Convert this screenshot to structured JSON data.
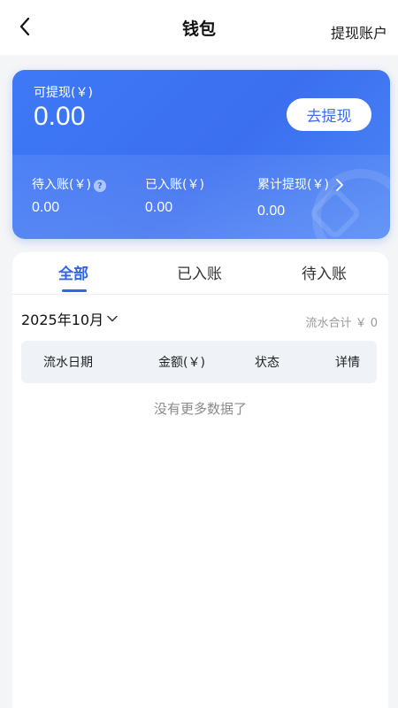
{
  "header": {
    "title": "钱包",
    "right_action": "提现账户"
  },
  "wallet": {
    "available_label": "可提现(￥)",
    "available_amount": "0.00",
    "withdraw_button": "去提现",
    "stats": [
      {
        "label": "待入账(￥)",
        "value": "0.00"
      },
      {
        "label": "已入账(￥)",
        "value": "0.00"
      },
      {
        "label": "累计提现(￥)",
        "value": "0.00"
      }
    ]
  },
  "tabs": [
    "全部",
    "已入账",
    "待入账"
  ],
  "filter": {
    "month": "2025年10月",
    "total_label": "流水合计 ￥ 0"
  },
  "table": {
    "columns": [
      "流水日期",
      "金额(￥)",
      "状态",
      "详情"
    ],
    "empty_text": "没有更多数据了"
  },
  "colors": {
    "accent": "#2f66e8",
    "card_start": "#3e79f7",
    "card_end": "#4d86f5"
  },
  "icons": {
    "back": "chevron-left-icon",
    "help": "question-circle-icon",
    "stat_arrow": "chevron-right-icon",
    "month_dropdown": "chevron-down-icon"
  }
}
